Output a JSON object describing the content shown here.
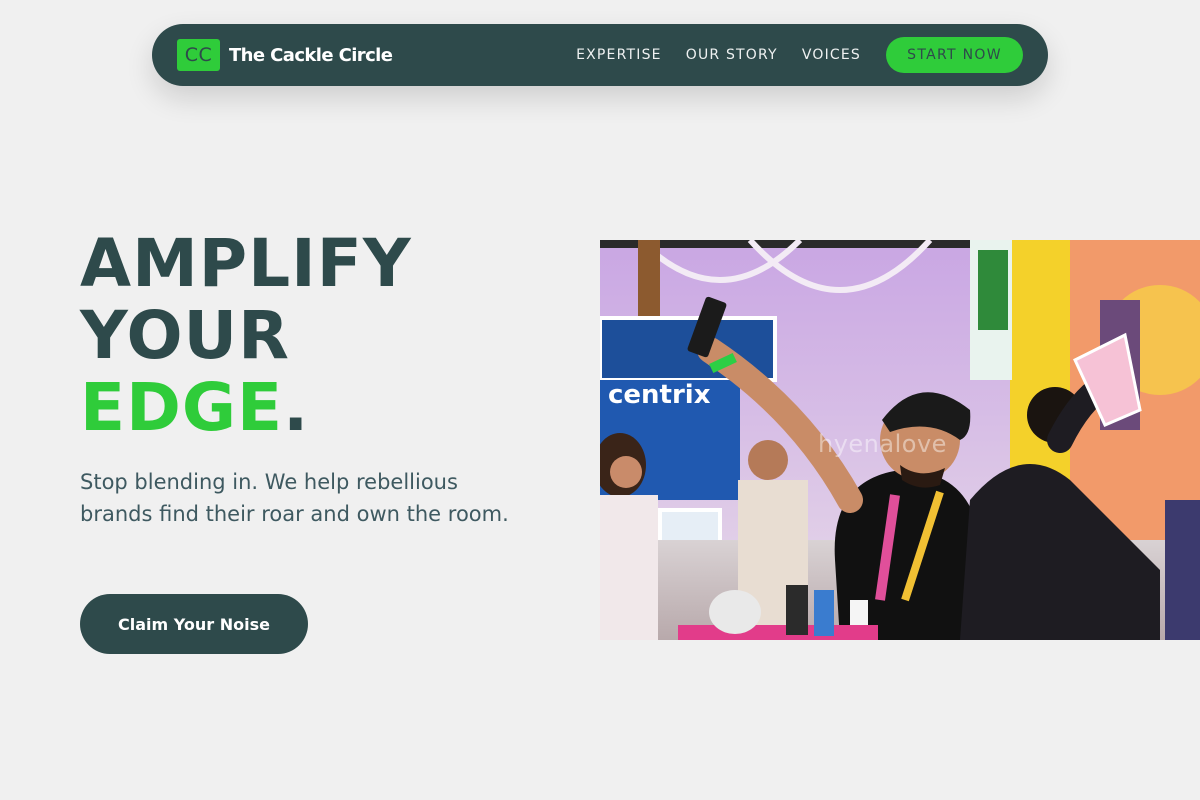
{
  "brand": {
    "logo_text": "CC",
    "name": "The Cackle Circle"
  },
  "nav": {
    "links": [
      "EXPERTISE",
      "OUR STORY",
      "VOICES"
    ],
    "cta": "START NOW"
  },
  "hero": {
    "title_line1": "AMPLIFY",
    "title_line2": "YOUR",
    "title_accent": "EDGE",
    "title_dot": ".",
    "subtitle": "Stop blending in. We help rebellious brands find their roar and own the room.",
    "cta": "Claim Your Noise",
    "image_watermark": "hyenalove",
    "image_sign_text": "centrix"
  },
  "colors": {
    "background": "#f0f0f0",
    "primary_dark": "#2e4a4b",
    "accent_green": "#2fcc3a",
    "subtitle_text": "#3e5960"
  },
  "icons": {
    "logo": "cc-monogram-icon"
  }
}
